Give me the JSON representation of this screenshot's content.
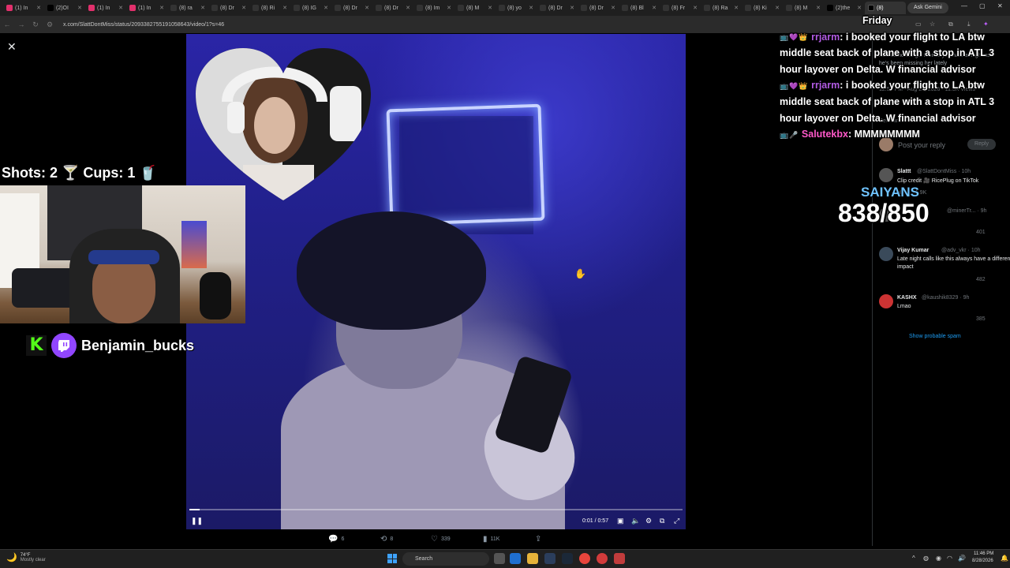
{
  "browser": {
    "tabs": [
      {
        "label": "(1) In",
        "color": "#e1306c"
      },
      {
        "label": "(2)OI",
        "color": "#000000"
      },
      {
        "label": "(1) In",
        "color": "#e1306c"
      },
      {
        "label": "(1) In",
        "color": "#e1306c"
      },
      {
        "label": "(8) ra",
        "color": "#333333"
      },
      {
        "label": "(8) Dr",
        "color": "#333333"
      },
      {
        "label": "(8) Ri",
        "color": "#333333"
      },
      {
        "label": "(8) IG",
        "color": "#333333"
      },
      {
        "label": "(8) Dr",
        "color": "#333333"
      },
      {
        "label": "(8) Dr",
        "color": "#333333"
      },
      {
        "label": "(8) Im",
        "color": "#333333"
      },
      {
        "label": "(8) M",
        "color": "#333333"
      },
      {
        "label": "(8) yo",
        "color": "#333333"
      },
      {
        "label": "(8) Dr",
        "color": "#333333"
      },
      {
        "label": "(8) Dr",
        "color": "#333333"
      },
      {
        "label": "(8) Bl",
        "color": "#333333"
      },
      {
        "label": "(8) Fr",
        "color": "#333333"
      },
      {
        "label": "(8) Ra",
        "color": "#333333"
      },
      {
        "label": "(8) Ki",
        "color": "#333333"
      },
      {
        "label": "(8) M",
        "color": "#333333"
      },
      {
        "label": "(2)the",
        "color": "#000000"
      }
    ],
    "active_tab": {
      "label": "(8)"
    },
    "new_tab": "+",
    "ask_gemini": "Ask Gemini",
    "url": "x.com/SlattDontMiss/status/2093382755191058643/video/1?s=46",
    "window_controls": {
      "minimize": "—",
      "maximize": "▢",
      "close": "✕"
    }
  },
  "video": {
    "close_icon": "✕",
    "progress": 0.02,
    "time": "0:01 / 0:57",
    "pause_icon": "❚❚"
  },
  "actions": {
    "replies": "6",
    "reposts": "8",
    "likes": "339",
    "views": "11K"
  },
  "stream": {
    "shots_cups": "Shots: 2 🍸 Cups: 1 🥤",
    "twitch_name": "Benjamin_bucks",
    "kick_letter": "K",
    "saiyans_label": "SAIYANS",
    "saiyans_count": "838/850"
  },
  "chat": {
    "partial_line": "Friday",
    "messages": [
      {
        "user": "rrjarm",
        "text": ": i booked your flight to LA btw middle seat back of plane with a stop in ATL 3 hour layover on Delta. W financial advisor"
      },
      {
        "user": "rrjarm",
        "text": ": i booked your flight to LA btw middle seat back of plane with a stop in ATL 3 hour layover on Delta. W financial advisor"
      },
      {
        "user": "Salutekbx",
        "text": ": MMMMMMMM"
      }
    ]
  },
  "sidebar": {
    "tweet_snippet": "how came the gal friends you hate at night as he's been missing her lately",
    "tweet_meta": "12:58 PM · Aug 28, 2026 · 11.3K Views",
    "relevant_label": "Relevant",
    "reply_placeholder": "Post your reply",
    "reply_button": "Reply",
    "replies": [
      {
        "name": "Slattt",
        "handle": "@SlattDontMiss · 10h",
        "text": "Clip credit 🎥 RicePlug on TikTok",
        "stats": "6 1.9K"
      },
      {
        "name": "",
        "handle": "@minerTr... · 9h",
        "text": "",
        "stats": "401"
      },
      {
        "name": "Vijay Kumar",
        "handle": "@adv_vkr · 10h",
        "text": "Late night calls like this always have a different impact",
        "stats": "482"
      },
      {
        "name": "KASHX",
        "handle": "@kaushik8329 · 9h",
        "text": "Lmao",
        "stats": "385"
      }
    ],
    "spam_link": "Show probable spam"
  },
  "taskbar": {
    "weather_temp": "74°F",
    "weather_desc": "Mostly clear",
    "search": "Search",
    "time": "11:46 PM",
    "date": "8/28/2026"
  }
}
